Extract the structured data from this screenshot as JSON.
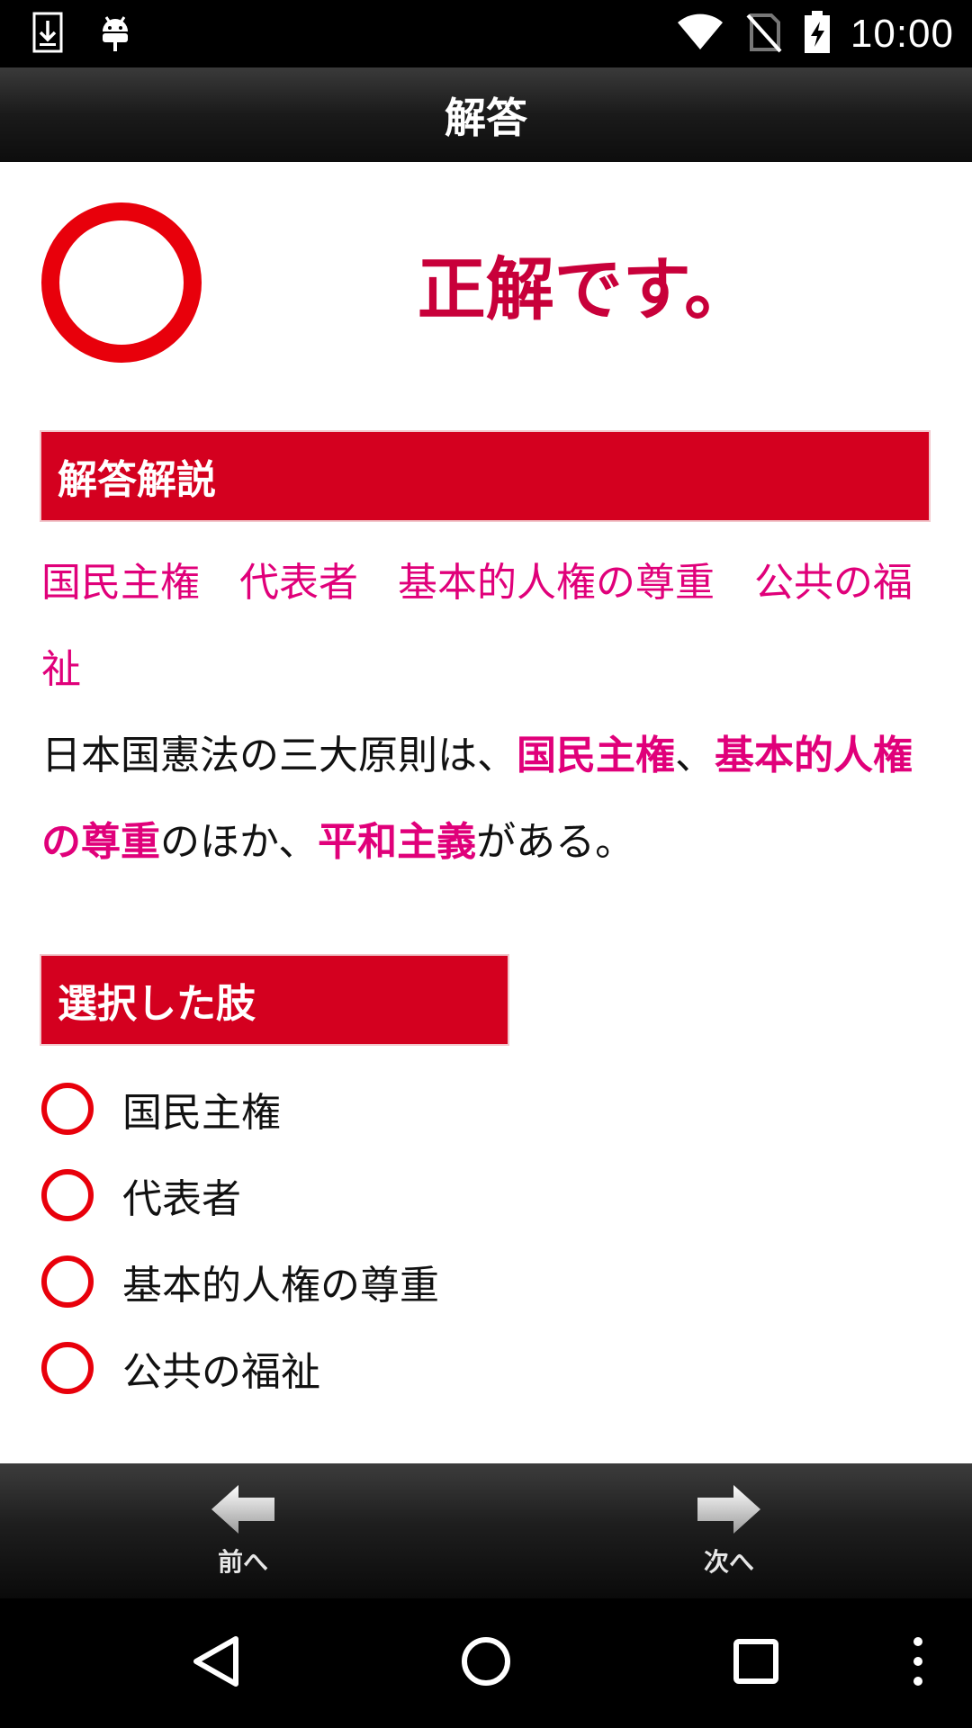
{
  "status_bar": {
    "time": "10:00",
    "icons_left": [
      "download-icon",
      "android-icon"
    ],
    "icons_right": [
      "wifi-icon",
      "no-sim-icon",
      "battery-charging-icon"
    ]
  },
  "header": {
    "title": "解答"
  },
  "result": {
    "text": "正解です。",
    "mark_color": "#e8000b",
    "text_color": "#c8003a"
  },
  "explanation_section": {
    "header": "解答解説",
    "keywords": [
      "国民主権",
      "代表者",
      "基本的人権の尊重",
      "公共の福祉"
    ],
    "body": {
      "part1": "日本国憲法の三大原則は、",
      "hl1": "国民主権",
      "part2": "、",
      "hl2": "基本的人権の尊重",
      "part3": "のほか、",
      "hl3": "平和主義",
      "part4": "がある。"
    }
  },
  "selection_section": {
    "header": "選択した肢",
    "choices": [
      "国民主権",
      "代表者",
      "基本的人権の尊重",
      "公共の福祉"
    ]
  },
  "bottom_nav": {
    "prev_label": "前へ",
    "next_label": "次へ"
  },
  "colors": {
    "accent_red": "#d4001f",
    "highlight_pink": "#e0007a"
  }
}
